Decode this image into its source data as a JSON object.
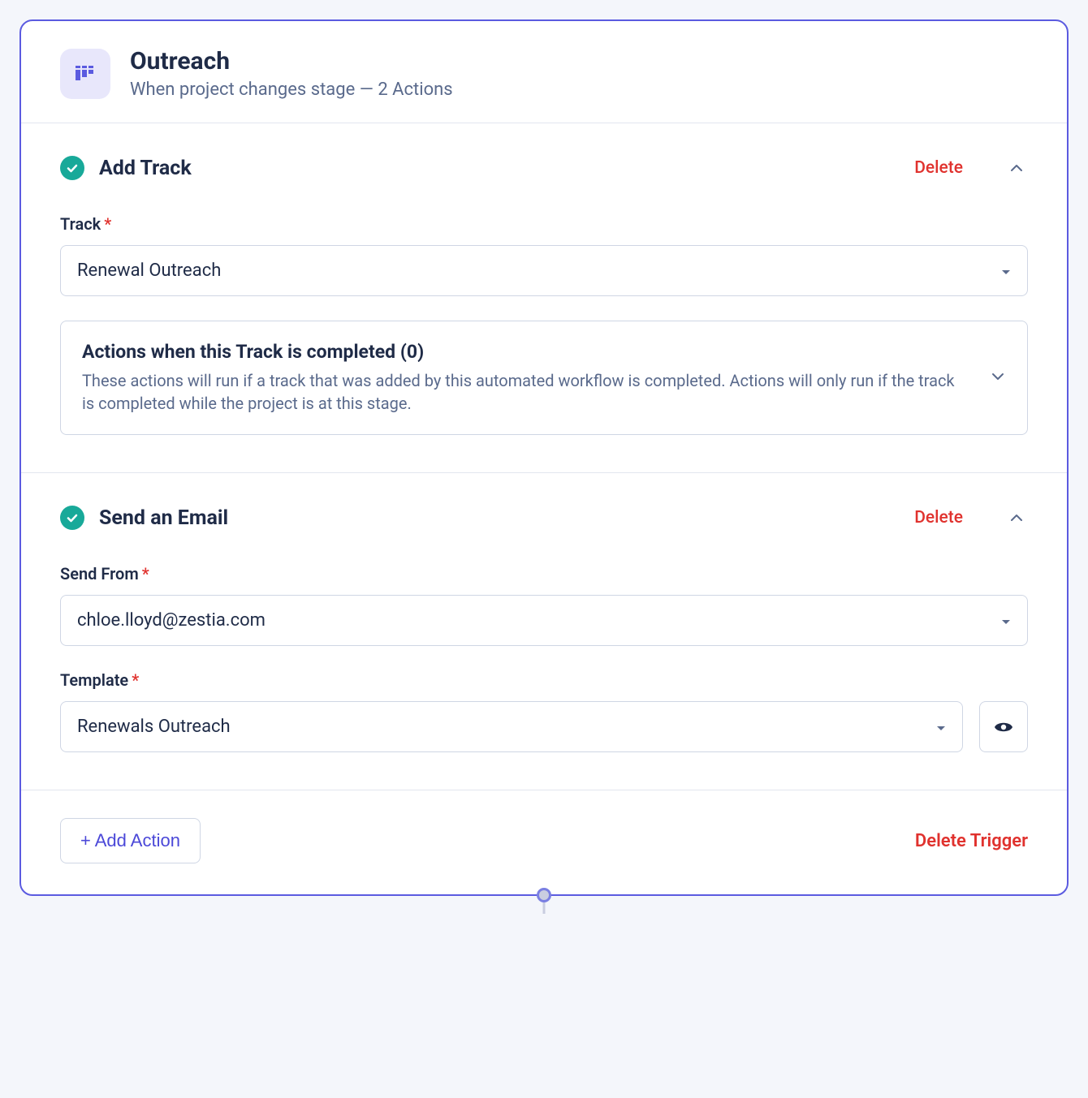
{
  "header": {
    "title": "Outreach",
    "subtitle": "When project changes stage — 2 Actions"
  },
  "actions": {
    "addTrack": {
      "title": "Add Track",
      "deleteLabel": "Delete",
      "fieldLabel": "Track",
      "fieldValue": "Renewal Outreach",
      "completion": {
        "title": "Actions when this Track is completed (0)",
        "description": "These actions will run if a track that was added by this automated workflow is completed. Actions will only run if the track is completed while the project is at this stage."
      }
    },
    "sendEmail": {
      "title": "Send an Email",
      "deleteLabel": "Delete",
      "fromLabel": "Send From",
      "fromValue": "chloe.lloyd@zestia.com",
      "templateLabel": "Template",
      "templateValue": "Renewals Outreach"
    }
  },
  "footer": {
    "addAction": "+ Add Action",
    "deleteTrigger": "Delete Trigger"
  }
}
